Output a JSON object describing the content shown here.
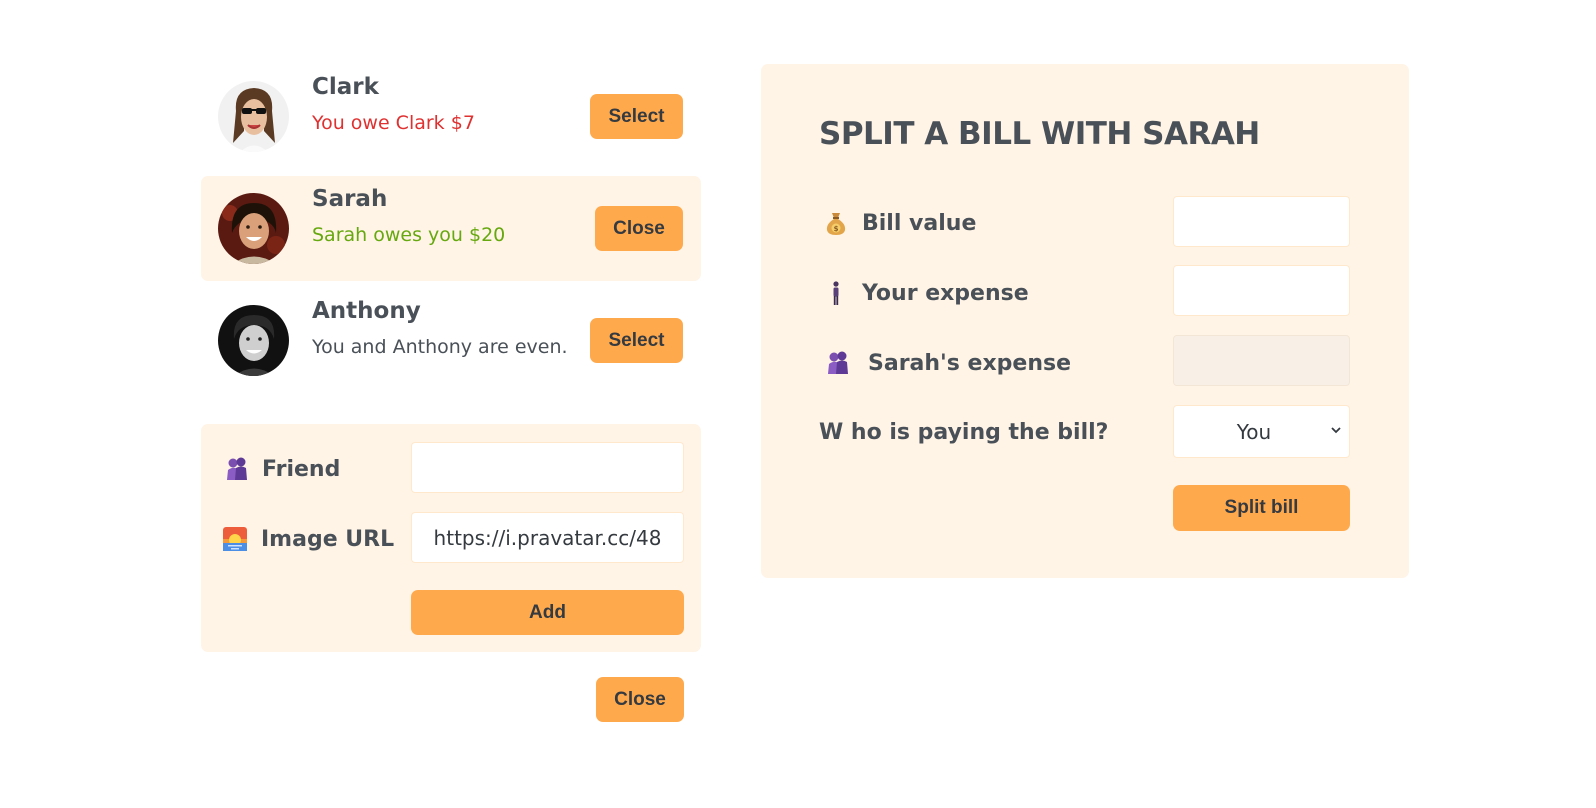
{
  "friends": [
    {
      "name": "Clark",
      "balance": "You owe Clark $7",
      "balance_status": "negative",
      "button_label": "Select",
      "selected": false
    },
    {
      "name": "Sarah",
      "balance": "Sarah owes you $20",
      "balance_status": "positive",
      "button_label": "Close",
      "selected": true
    },
    {
      "name": "Anthony",
      "balance": "You and Anthony are even.",
      "balance_status": "even",
      "button_label": "Select",
      "selected": false
    }
  ],
  "add_friend_form": {
    "friend_label": "Friend",
    "friend_value": "",
    "image_url_label": "Image URL",
    "image_url_value": "https://i.pravatar.cc/48",
    "add_button": "Add"
  },
  "close_form_button": "Close",
  "split_bill": {
    "title": "SPLIT A BILL WITH SARAH",
    "bill_value_label": "Bill value",
    "bill_value": "",
    "your_expense_label": "Your expense",
    "your_expense": "",
    "friend_expense_label": "Sarah's expense",
    "friend_expense": "",
    "payer_label": "W ho is paying the bill?",
    "payer_selected": "You",
    "submit_button": "Split bill"
  },
  "colors": {
    "accent": "#ffa94d",
    "panel_background": "#fff4e6",
    "negative": "#e03131",
    "positive": "#66a80f",
    "text": "#495057"
  },
  "icons": {
    "bill_value": "money-bag-icon",
    "your_expense": "person-standing-icon",
    "friend_expense": "people-hugging-icon",
    "friend": "people-hugging-icon",
    "image_url": "sunrise-image-icon",
    "select_chevron": "chevron-down-icon"
  }
}
